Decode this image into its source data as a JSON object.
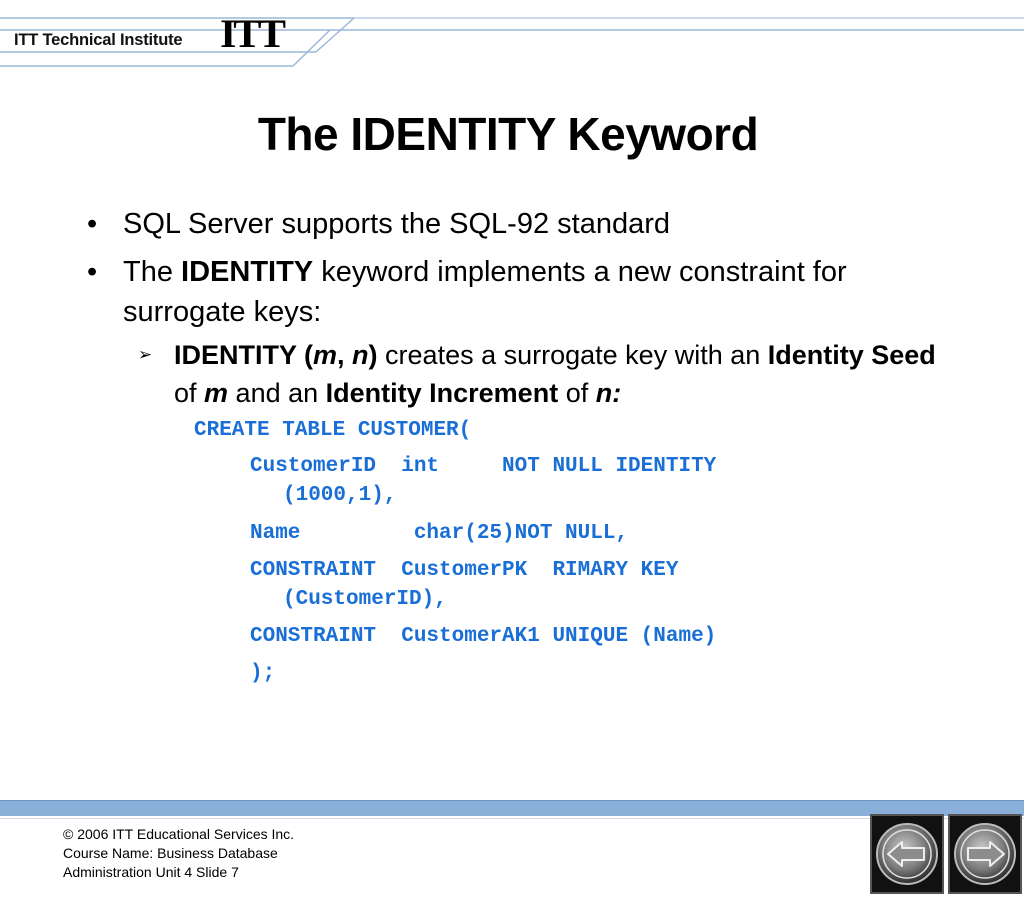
{
  "header": {
    "institute": "ITT Technical Institute",
    "logo": "ITT"
  },
  "title": "The IDENTITY Keyword",
  "bullets": [
    {
      "symbol": "•",
      "text": "SQL Server supports the SQL-92 standard"
    },
    {
      "symbol": "•",
      "pre": "The ",
      "bold": "IDENTITY",
      "post": " keyword implements a new constraint for surrogate keys:"
    }
  ],
  "sub_bullet": {
    "symbol": "➢",
    "b1": "IDENTITY (",
    "i1": "m",
    "b2": ", ",
    "i2": "n",
    "b3": ")",
    "t1": " creates a surrogate key with an ",
    "b4": "Identity Seed",
    "t2": " of ",
    "i3": "m",
    "t3": " and an ",
    "b5": "Identity Increment",
    "t4": " of ",
    "i4": "n:"
  },
  "code": [
    "CREATE TABLE CUSTOMER(",
    "CustomerID  int     NOT NULL IDENTITY",
    "(1000,1),",
    "Name         char(25)NOT NULL,",
    "CONSTRAINT  CustomerPK  RIMARY KEY",
    "(CustomerID),",
    "CONSTRAINT  CustomerAK1 UNIQUE (Name)",
    ");"
  ],
  "footer": {
    "line1": "© 2006 ITT Educational Services Inc.",
    "line2": "Course Name: Business Database",
    "line3": "Administration Unit 4 Slide 7"
  },
  "nav": {
    "prev_icon": "arrow-left-icon",
    "next_icon": "arrow-right-icon"
  },
  "colors": {
    "code": "#1a6fd6",
    "footer_bar": "#8aafd8",
    "header_lines": "#9bb8d8"
  }
}
